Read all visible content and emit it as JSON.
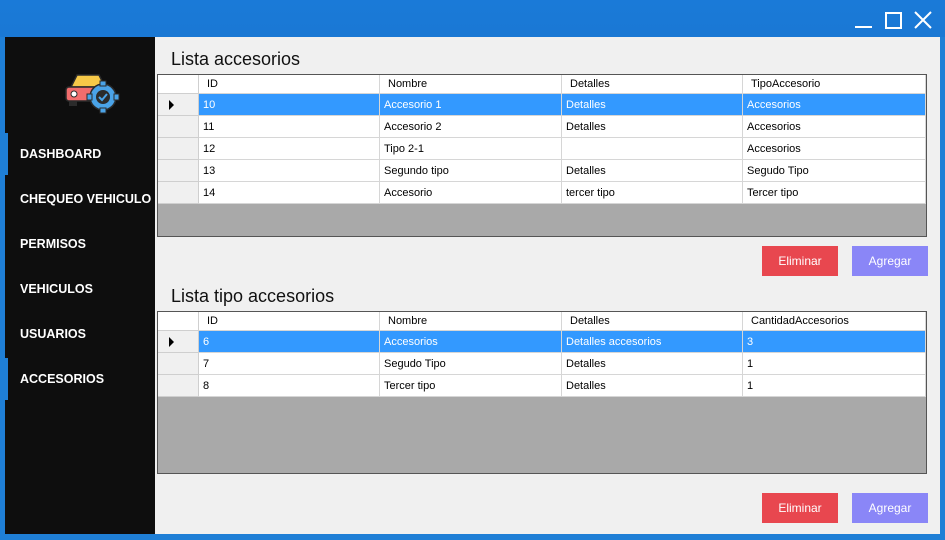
{
  "window": {
    "controls": [
      "minimize-icon",
      "maximize-icon",
      "close-icon"
    ]
  },
  "sidebar": {
    "logo": "car-gear-icon",
    "items": [
      {
        "label": "DASHBOARD"
      },
      {
        "label": "CHEQUEO VEHICULO"
      },
      {
        "label": "PERMISOS"
      },
      {
        "label": "VEHICULOS"
      },
      {
        "label": "USUARIOS"
      },
      {
        "label": "ACCESORIOS"
      }
    ]
  },
  "accesorios": {
    "title": "Lista accesorios",
    "columns": [
      "ID",
      "Nombre",
      "Detalles",
      "TipoAccesorio"
    ],
    "rows": [
      [
        "10",
        "Accesorio 1",
        "Detalles",
        "Accesorios"
      ],
      [
        "11",
        "Accesorio 2",
        "Detalles",
        "Accesorios"
      ],
      [
        "12",
        "Tipo 2-1",
        "",
        "Accesorios"
      ],
      [
        "13",
        "Segundo tipo",
        "Detalles",
        "Segudo Tipo"
      ],
      [
        "14",
        "Accesorio",
        "tercer tipo",
        "Tercer tipo"
      ]
    ],
    "delete_label": "Eliminar",
    "add_label": "Agregar"
  },
  "tipos": {
    "title": "Lista tipo accesorios",
    "columns": [
      "ID",
      "Nombre",
      "Detalles",
      "CantidadAccesorios"
    ],
    "rows": [
      [
        "6",
        "Accesorios",
        "Detalles accesorios",
        "3"
      ],
      [
        "7",
        "Segudo Tipo",
        "Detalles",
        "1"
      ],
      [
        "8",
        "Tercer tipo",
        "Detalles",
        "1"
      ]
    ],
    "delete_label": "Eliminar",
    "add_label": "Agregar"
  },
  "colors": {
    "titlebar": "#1f7fd6",
    "sidebar": "#0e0e0e",
    "selected_row": "#3399ff",
    "delete_button": "#e8474f",
    "add_button": "#8a86f7"
  }
}
